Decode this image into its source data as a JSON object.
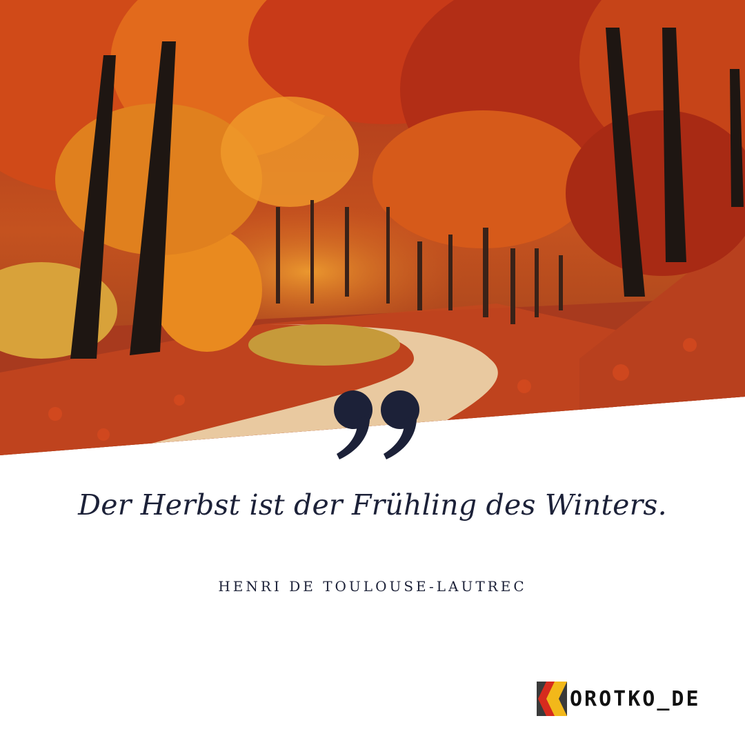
{
  "quote": {
    "text": "Der Herbst ist der Frühling des Winters.",
    "author": "HENRI DE TOULOUSE-LAUTREC"
  },
  "brand": {
    "name": "OROTKO_DE",
    "logo_letter": "K"
  },
  "colors": {
    "text": "#1c2138",
    "background": "#ffffff",
    "foliage_red": "#b8361c",
    "foliage_orange": "#e0781e",
    "brand_grey": "#3a3a3a",
    "brand_red": "#d62b1e",
    "brand_gold": "#f2b81a"
  },
  "icons": {
    "quote": "closing-quotation-mark-icon",
    "logo": "korotko-logo-icon"
  }
}
